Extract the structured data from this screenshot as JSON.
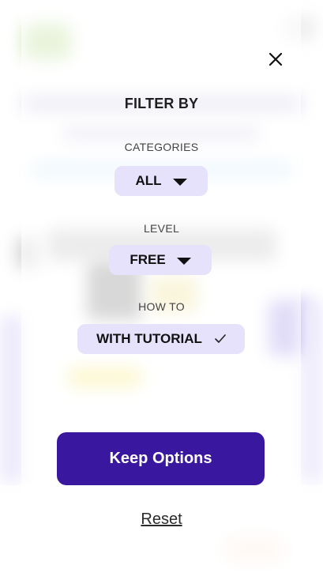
{
  "modal": {
    "title": "FILTER BY",
    "sections": {
      "categories": {
        "label": "CATEGORIES",
        "value": "ALL"
      },
      "level": {
        "label": "LEVEL",
        "value": "FREE"
      },
      "how_to": {
        "label": "HOW TO",
        "value": "WITH TUTORIAL"
      }
    },
    "primary_button": "Keep Options",
    "reset_link": "Reset"
  },
  "icons": {
    "close": "close-icon",
    "dropdown": "caret-down-icon",
    "check": "checkmark-icon"
  },
  "colors": {
    "primary": "#3a179f",
    "chip_background": "#e6e2fb",
    "text_dark": "#1f1f1f"
  }
}
